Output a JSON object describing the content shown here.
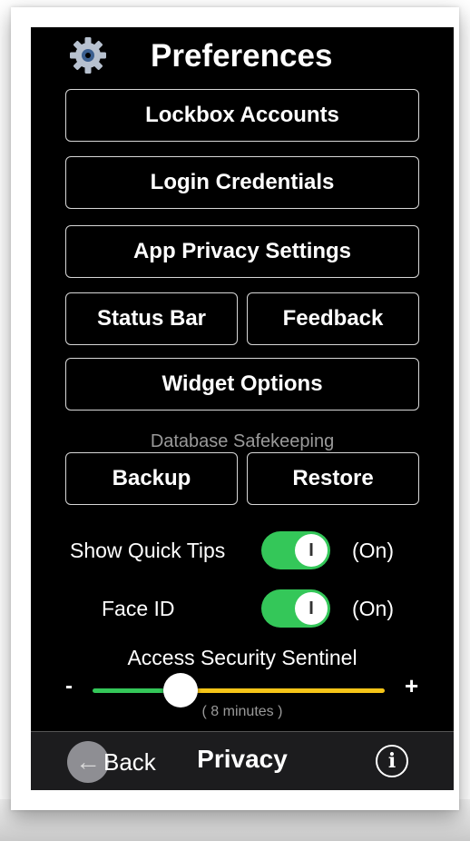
{
  "header": {
    "title": "Preferences",
    "icon": "gear-icon"
  },
  "menu": {
    "lockbox_accounts": "Lockbox Accounts",
    "login_credentials": "Login Credentials",
    "app_privacy_settings": "App Privacy Settings",
    "status_bar": "Status Bar",
    "feedback": "Feedback",
    "widget_options": "Widget Options"
  },
  "database": {
    "section_label": "Database Safekeeping",
    "backup": "Backup",
    "restore": "Restore"
  },
  "toggles": {
    "quick_tips": {
      "label": "Show Quick Tips",
      "state": "(On)",
      "on": true,
      "knob": "I"
    },
    "face_id": {
      "label": "Face ID",
      "state": "(On)",
      "on": true,
      "knob": "I"
    }
  },
  "sentinel": {
    "title": "Access Security Sentinel",
    "minus": "-",
    "plus": "+",
    "value_text": "( 8 minutes )",
    "level_fraction": 0.3,
    "colors": {
      "low": "#34c759",
      "high": "#f5c518"
    }
  },
  "bottom_bar": {
    "back_icon": "arrow-left-icon",
    "back_glyph": "←",
    "back_label": "Back",
    "title": "Privacy",
    "info_icon": "info-icon",
    "info_glyph": "i"
  },
  "colors": {
    "accent_toggle": "#34c759",
    "background": "#000000"
  }
}
